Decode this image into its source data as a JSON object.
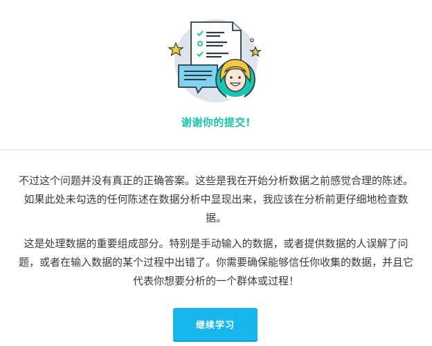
{
  "header": {
    "illustration_icon": "survey-checklist-person-icon",
    "thanks_text": "谢谢你的提交!"
  },
  "body": {
    "paragraphs": [
      "不过这个问题并没有真正的正确答案。这些是我在开始分析数据之前感觉合理的陈述。如果此处未勾选的任何陈述在数据分析中显现出来，我应该在分析前更仔细地检查数据。",
      "这是处理数据的重要组成部分。特别是手动输入的数据，或者提供数据的人误解了问题，或者在输入数据的某个过程中出错了。你需要确保能够信任你收集的数据，并且它代表你想要分析的一个群体或过程！"
    ]
  },
  "actions": {
    "continue_label": "继续学习"
  },
  "colors": {
    "accent_teal": "#1cc3ad",
    "button_blue": "#17b6ec",
    "divider": "#dcdcdc"
  }
}
